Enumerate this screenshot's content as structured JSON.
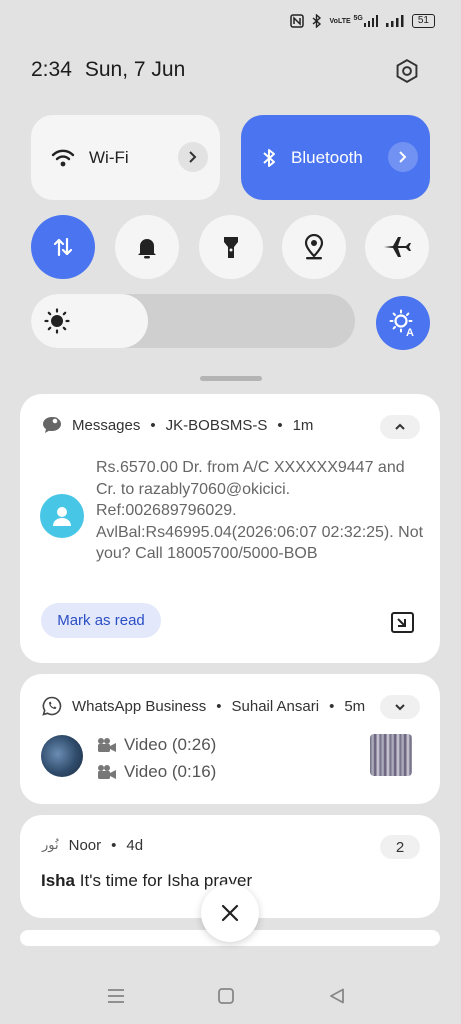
{
  "status": {
    "icons": [
      "nfc-icon",
      "bluetooth-icon",
      "volte-icon",
      "signal-5g-icon",
      "signal-icon",
      "battery-icon"
    ],
    "volte": "VoLTE",
    "net5g": "5G",
    "battery": "51"
  },
  "header": {
    "time": "2:34",
    "date": "Sun, 7 Jun"
  },
  "tiles": {
    "wifi": "Wi-Fi",
    "bluetooth": "Bluetooth"
  },
  "colors": {
    "accent": "#4a74f0",
    "tile": "#f5f5f5",
    "background": "#e2e2e2"
  },
  "brightness": {
    "level": 0.36
  },
  "notifications": [
    {
      "app": "Messages",
      "sender": "JK-BOBSMS-S",
      "time": "1m",
      "body": "Rs.6570.00 Dr. from A/C XXXXXX9447 and Cr. to razably7060@okicici. Ref:002689796029. AvlBal:Rs46995.04(2026:06:07 02:32:25). Not you? Call 18005700/5000-BOB",
      "action": "Mark as read"
    },
    {
      "app": "WhatsApp Business",
      "sender": "Suhail Ansari",
      "time": "5m",
      "lines": [
        "Video (0:26)",
        "Video (0:16)"
      ]
    },
    {
      "app": "Noor",
      "time": "4d",
      "count": "2",
      "title": "Isha",
      "text": "It's time for Isha prayer",
      "app_logo": "نُور"
    }
  ],
  "sep": "•"
}
